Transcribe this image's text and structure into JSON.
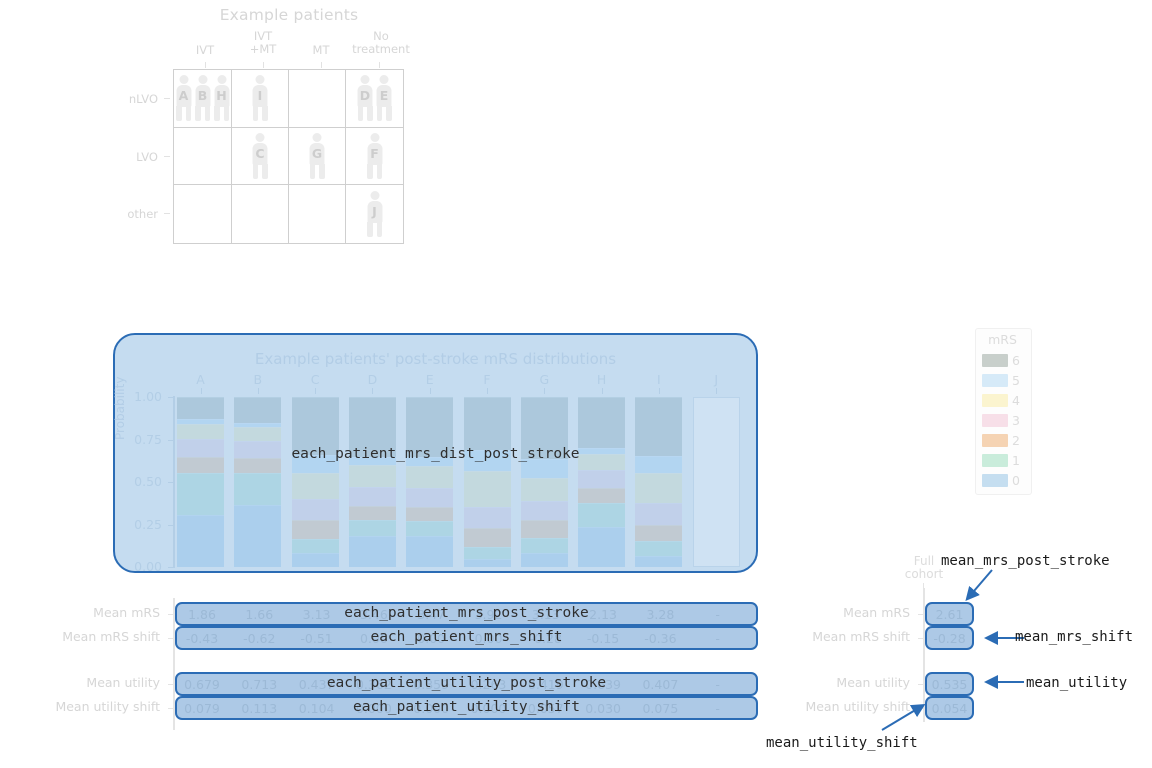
{
  "patient_grid": {
    "title": "Example patients",
    "col_headers": [
      "IVT",
      "IVT\n+MT",
      "MT",
      "No\ntreatment"
    ],
    "row_headers": [
      "nLVO",
      "LVO",
      "other"
    ],
    "cells": [
      [
        "A",
        "B",
        "H"
      ],
      [
        "I"
      ],
      [],
      [
        "D",
        "E"
      ],
      [],
      [
        "C"
      ],
      [
        "G"
      ],
      [
        "F"
      ],
      [],
      [],
      [],
      [
        "J"
      ]
    ]
  },
  "mrs_panel": {
    "title": "Example patients' post-stroke mRS distributions",
    "ylabel": "Probability",
    "ytick_labels": [
      "1.00",
      "0.75",
      "0.50",
      "0.25",
      "0.00"
    ],
    "ytick_values": [
      1.0,
      0.75,
      0.5,
      0.25,
      0.0
    ],
    "column_letters": [
      "A",
      "B",
      "C",
      "D",
      "E",
      "F",
      "G",
      "H",
      "I",
      "J"
    ],
    "overlay_label": "each_patient_mrs_dist_post_stroke"
  },
  "legend": {
    "title": "mRS",
    "entries": [
      {
        "label": "6",
        "color": "#c8cfcb"
      },
      {
        "label": "5",
        "color": "#d6eaf8"
      },
      {
        "label": "4",
        "color": "#fbf4cf"
      },
      {
        "label": "3",
        "color": "#f7dfe8"
      },
      {
        "label": "2",
        "color": "#f5d3b3"
      },
      {
        "label": "1",
        "color": "#c9ecdb"
      },
      {
        "label": "0",
        "color": "#c5def0"
      }
    ]
  },
  "chart_data": {
    "type": "bar",
    "stacked": true,
    "title": "Example patients' post-stroke mRS distributions",
    "xlabel": "",
    "ylabel": "Probability",
    "ylim": [
      0,
      1
    ],
    "categories": [
      "A",
      "B",
      "C",
      "D",
      "E",
      "F",
      "G",
      "H",
      "I",
      "J"
    ],
    "series": [
      {
        "name": "0",
        "color": "#c5def0",
        "values": [
          0.305,
          0.365,
          0.085,
          0.185,
          0.185,
          0.045,
          0.085,
          0.235,
          0.065,
          null
        ]
      },
      {
        "name": "1",
        "color": "#c9ecdb",
        "values": [
          0.25,
          0.19,
          0.08,
          0.09,
          0.085,
          0.075,
          0.085,
          0.14,
          0.085,
          null
        ]
      },
      {
        "name": "2",
        "color": "#f5d3b3",
        "values": [
          0.09,
          0.085,
          0.11,
          0.085,
          0.085,
          0.11,
          0.105,
          0.09,
          0.095,
          null
        ]
      },
      {
        "name": "3",
        "color": "#f7dfe8",
        "values": [
          0.105,
          0.1,
          0.125,
          0.11,
          0.11,
          0.125,
          0.115,
          0.105,
          0.13,
          null
        ]
      },
      {
        "name": "4",
        "color": "#fbf4cf",
        "values": [
          0.09,
          0.085,
          0.15,
          0.13,
          0.13,
          0.21,
          0.135,
          0.095,
          0.175,
          null
        ]
      },
      {
        "name": "5",
        "color": "#d6eaf8",
        "values": [
          0.03,
          0.025,
          0.11,
          0.05,
          0.05,
          0.125,
          0.11,
          0.035,
          0.105,
          null
        ]
      },
      {
        "name": "6",
        "color": "#c8cfcb",
        "values": [
          0.13,
          0.15,
          0.34,
          0.35,
          0.355,
          0.31,
          0.365,
          0.3,
          0.345,
          null
        ]
      }
    ]
  },
  "patient_table": {
    "rows": [
      {
        "label": "Mean mRS",
        "values": [
          "1.86",
          "1.66",
          "3.13",
          "3.46",
          "3.47",
          "3.92",
          "3.13",
          "2.13",
          "3.28",
          "-"
        ],
        "overlay": "each_patient_mrs_post_stroke"
      },
      {
        "label": "Mean mRS shift",
        "values": [
          "-0.43",
          "-0.62",
          "-0.51",
          "0.00",
          "0.00",
          "0.00",
          "-0.28",
          "-0.15",
          "-0.36",
          "-"
        ],
        "overlay": "each_patient_mrs_shift"
      },
      {
        "label": "Mean utility",
        "values": [
          "0.679",
          "0.713",
          "0.437",
          "0.362",
          "0.359",
          "0.263",
          "0.419",
          "0.639",
          "0.407",
          "-"
        ],
        "overlay": "each_patient_utility_post_stroke"
      },
      {
        "label": "Mean utility shift",
        "values": [
          "0.079",
          "0.113",
          "0.104",
          "0.000",
          "0.000",
          "0.000",
          "0.057",
          "0.030",
          "0.075",
          "-"
        ],
        "overlay": "each_patient_utility_shift"
      }
    ]
  },
  "cohort_table": {
    "header": "Full\ncohort",
    "rows": [
      {
        "label": "Mean mRS",
        "value": "2.61",
        "annotation": "mean_mrs_post_stroke"
      },
      {
        "label": "Mean mRS shift",
        "value": "-0.28",
        "annotation": "mean_mrs_shift"
      },
      {
        "label": "Mean utility",
        "value": "0.535",
        "annotation": "mean_utility"
      },
      {
        "label": "Mean utility shift",
        "value": "0.054",
        "annotation": "mean_utility_shift"
      }
    ]
  },
  "colors": {
    "panel_fill": "#c5dcf0",
    "panel_border": "#2b6cb5",
    "table_fill": "#adc9e6",
    "arrow": "#2b6cb5"
  }
}
